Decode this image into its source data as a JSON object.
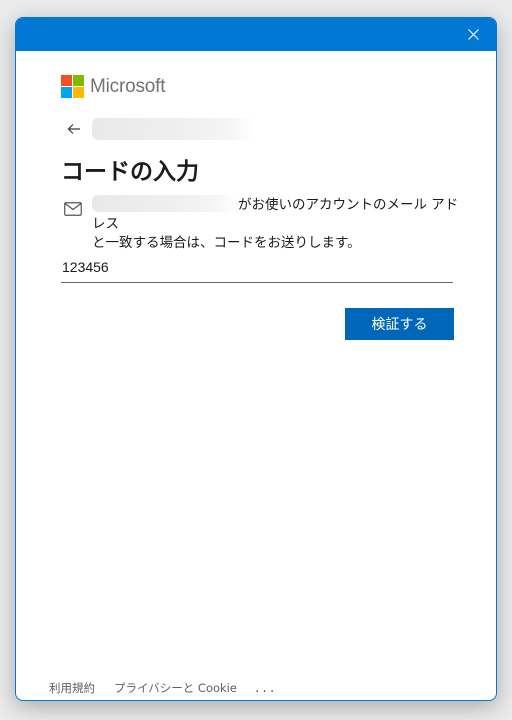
{
  "brand": {
    "name": "Microsoft",
    "logo_colors": [
      "#f25022",
      "#7fba00",
      "#00a4ef",
      "#ffb900"
    ],
    "accent": "#0078d4",
    "button_color": "#0067b8"
  },
  "titlebar": {
    "close_icon": "close-icon"
  },
  "back": {
    "icon": "arrow-left-icon"
  },
  "main": {
    "title": "コードの入力",
    "description_line1": "がお使いのアカウントのメール アドレス",
    "description_line2": "と一致する場合は、コードをお送りします。",
    "mail_icon": "mail-icon",
    "code_value": "123456",
    "verify_label": "検証する"
  },
  "footer": {
    "terms": "利用規約",
    "privacy": "プライバシーと Cookie",
    "more": "..."
  }
}
